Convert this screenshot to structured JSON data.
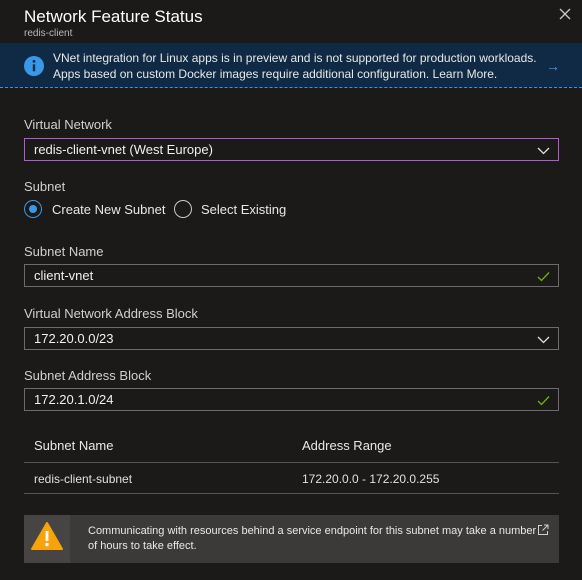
{
  "header": {
    "title": "Network Feature Status",
    "subtitle": "redis-client",
    "close_icon": "close-icon"
  },
  "info_banner": {
    "icon": "info-icon",
    "text": "VNet integration for Linux apps is in preview and is not supported for production workloads. Apps based on custom Docker images require additional configuration. Learn More.",
    "arrow_icon": "arrow-right-icon",
    "color": "#102a45"
  },
  "form": {
    "vnet_label": "Virtual Network",
    "vnet_value": "redis-client-vnet (West Europe)",
    "subnet_label": "Subnet",
    "radio_create": "Create New Subnet",
    "radio_existing": "Select Existing",
    "radio_selected": "Create New Subnet",
    "subnet_name_label": "Subnet Name",
    "subnet_name_value": "client-vnet",
    "vnet_address_label": "Virtual Network Address Block",
    "vnet_address_value": "172.20.0.0/23",
    "subnet_address_label": "Subnet Address Block",
    "subnet_address_value": "172.20.1.0/24"
  },
  "table": {
    "headers": [
      "Subnet Name",
      "Address Range"
    ],
    "rows": [
      [
        "redis-client-subnet",
        "172.20.0.0 - 172.20.0.255"
      ]
    ]
  },
  "warning": {
    "icon": "warning-icon",
    "text": "Communicating with resources behind a service endpoint for this subnet may take a number of hours to take effect.",
    "external_icon": "external-link-icon"
  },
  "colors": {
    "accent": "#3899e8",
    "focus_border": "#b25bd8",
    "valid_check": "#6bb700",
    "warning": "#f7a30c"
  }
}
